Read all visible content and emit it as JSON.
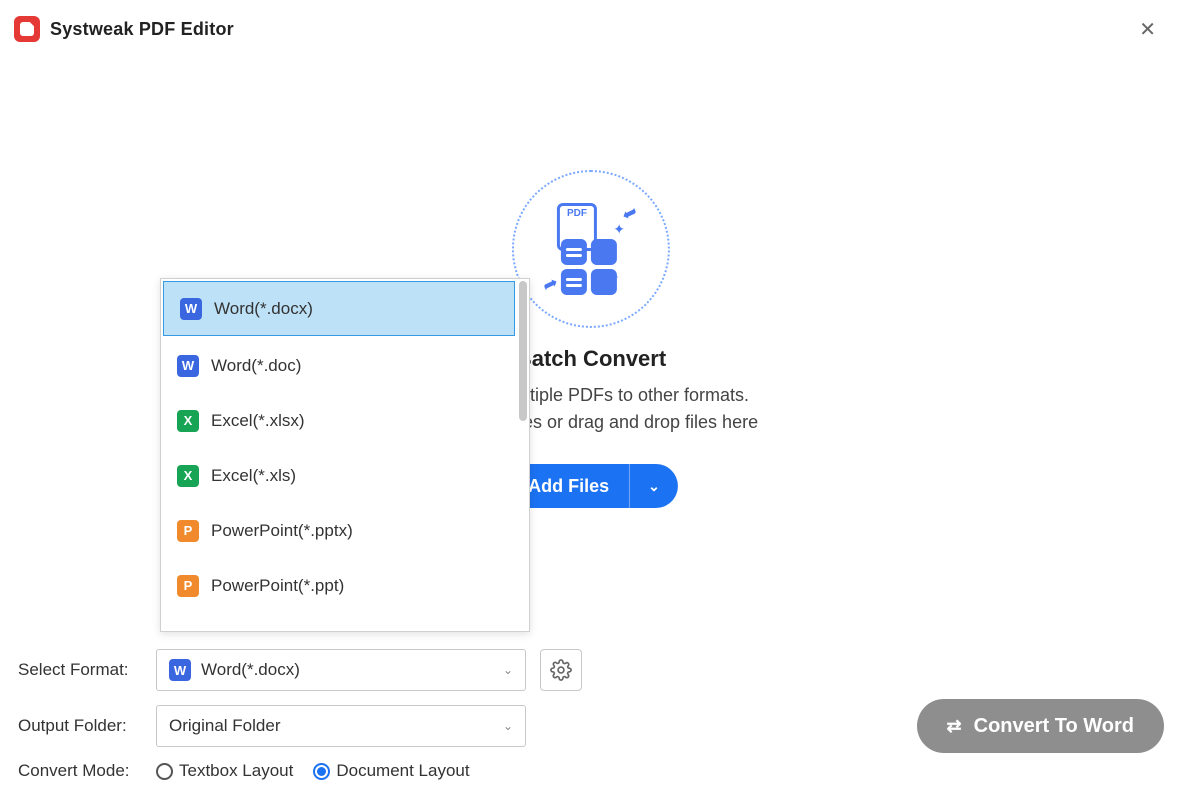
{
  "titlebar": {
    "title": "Systweak PDF Editor"
  },
  "center": {
    "heading": "Batch Convert",
    "line1": "Convert multiple PDFs to other formats.",
    "line2": "Click Add Files or drag and drop files here",
    "add_label": "Add Files",
    "pdf_badge": "PDF"
  },
  "format_options": [
    {
      "icon": "word",
      "label": "Word(*.docx)",
      "selected": true
    },
    {
      "icon": "word",
      "label": "Word(*.doc)"
    },
    {
      "icon": "excel",
      "label": "Excel(*.xlsx)"
    },
    {
      "icon": "excel",
      "label": "Excel(*.xls)"
    },
    {
      "icon": "ppt",
      "label": "PowerPoint(*.pptx)"
    },
    {
      "icon": "ppt",
      "label": "PowerPoint(*.ppt)"
    }
  ],
  "controls": {
    "format_label": "Select Format:",
    "format_value": "Word(*.docx)",
    "output_label": "Output Folder:",
    "output_value": "Original Folder",
    "mode_label": "Convert Mode:",
    "mode_textbox": "Textbox Layout",
    "mode_document": "Document Layout"
  },
  "convert_button": "Convert To Word",
  "icon_letters": {
    "word": "W",
    "excel": "X",
    "ppt": "P"
  }
}
